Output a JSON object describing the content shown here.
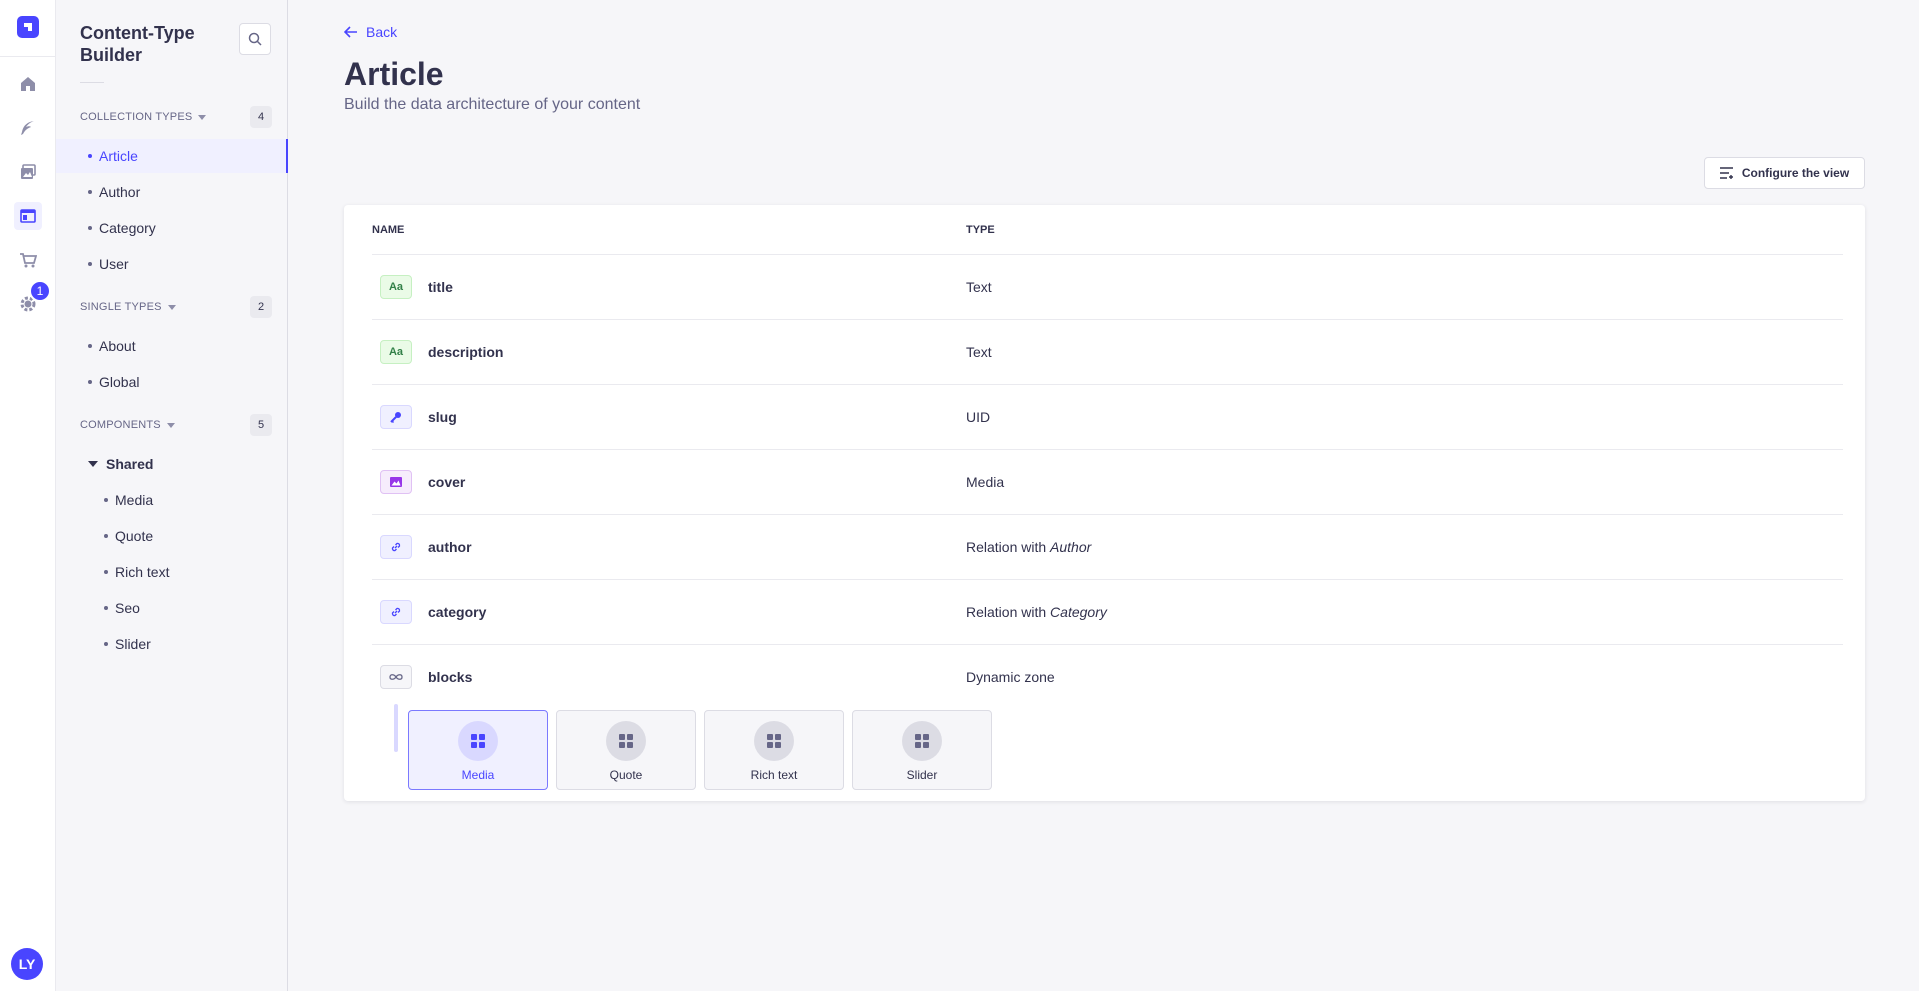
{
  "app": {
    "avatar_initials": "LY",
    "settings_badge": "1"
  },
  "colors": {
    "primary": "#4945ff",
    "text_green_icon": "#328048",
    "text_icon_bg": "#eafbe7"
  },
  "subnav": {
    "title": "Content-Type Builder",
    "collection": {
      "label": "COLLECTION TYPES",
      "count": "4",
      "items": [
        "Article",
        "Author",
        "Category",
        "User"
      ]
    },
    "single": {
      "label": "SINGLE TYPES",
      "count": "2",
      "items": [
        "About",
        "Global"
      ]
    },
    "components": {
      "label": "COMPONENTS",
      "count": "5",
      "group": "Shared",
      "items": [
        "Media",
        "Quote",
        "Rich text",
        "Seo",
        "Slider"
      ]
    }
  },
  "header": {
    "back": "Back",
    "title": "Article",
    "subtitle": "Build the data architecture of your content",
    "configure": "Configure the view"
  },
  "table": {
    "col_name": "NAME",
    "col_type": "TYPE",
    "rows": [
      {
        "icon": "text-icon",
        "icon_text": "Aa",
        "name": "title",
        "type": "Text",
        "type_target": ""
      },
      {
        "icon": "text-icon",
        "icon_text": "Aa",
        "name": "description",
        "type": "Text",
        "type_target": ""
      },
      {
        "icon": "key-icon",
        "icon_text": "",
        "name": "slug",
        "type": "UID",
        "type_target": ""
      },
      {
        "icon": "media-icon",
        "icon_text": "",
        "name": "cover",
        "type": "Media",
        "type_target": ""
      },
      {
        "icon": "link-icon",
        "icon_text": "",
        "name": "author",
        "type": "Relation with",
        "type_target": "Author"
      },
      {
        "icon": "link-icon",
        "icon_text": "",
        "name": "category",
        "type": "Relation with",
        "type_target": "Category"
      },
      {
        "icon": "infinity-icon",
        "icon_text": "",
        "name": "blocks",
        "type": "Dynamic zone",
        "type_target": ""
      }
    ],
    "dynamic_zone": [
      "Media",
      "Quote",
      "Rich text",
      "Slider"
    ]
  }
}
